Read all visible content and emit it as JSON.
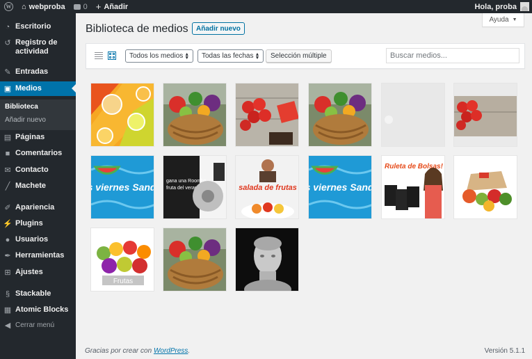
{
  "adminbar": {
    "site_name": "webproba",
    "comments_count": "0",
    "new_label": "Añadir",
    "greeting": "Hola, proba"
  },
  "sidebar": {
    "items": [
      {
        "label": "Escritorio",
        "icon": "dashboard-icon"
      },
      {
        "label": "Registro de actividad",
        "icon": "activity-log-icon"
      },
      {
        "label": "Entradas",
        "icon": "pin-icon"
      },
      {
        "label": "Medios",
        "icon": "media-icon"
      },
      {
        "label": "Páginas",
        "icon": "pages-icon"
      },
      {
        "label": "Comentarios",
        "icon": "comments-icon"
      },
      {
        "label": "Contacto",
        "icon": "mail-icon"
      },
      {
        "label": "Machete",
        "icon": "machete-icon"
      },
      {
        "label": "Apariencia",
        "icon": "brush-icon"
      },
      {
        "label": "Plugins",
        "icon": "plugin-icon"
      },
      {
        "label": "Usuarios",
        "icon": "users-icon"
      },
      {
        "label": "Herramientas",
        "icon": "wrench-icon"
      },
      {
        "label": "Ajustes",
        "icon": "settings-icon"
      },
      {
        "label": "Stackable",
        "icon": "stackable-icon"
      },
      {
        "label": "Atomic Blocks",
        "icon": "atomic-blocks-icon"
      }
    ],
    "submenu": [
      {
        "label": "Biblioteca"
      },
      {
        "label": "Añadir nuevo"
      }
    ],
    "collapse_label": "Cerrar menú"
  },
  "help_tab": {
    "label": "Ayuda"
  },
  "page": {
    "title": "Biblioteca de medios",
    "add_new_label": "Añadir nuevo"
  },
  "toolbar": {
    "type_filter": "Todos los medios",
    "date_filter": "Todas las fechas",
    "bulk_select_label": "Selección múltiple",
    "search_placeholder": "Buscar medios..."
  },
  "media": [
    {
      "kind": "oranges",
      "caption": ""
    },
    {
      "kind": "vegetable-basket",
      "caption": ""
    },
    {
      "kind": "tomatoes-wood",
      "caption": ""
    },
    {
      "kind": "vegetable-basket",
      "caption": ""
    },
    {
      "kind": "placeholder",
      "caption": ""
    },
    {
      "kind": "tomatoes-wood-plain",
      "caption": ""
    },
    {
      "kind": "watermelon-pool",
      "caption": "Los viernes Sandía!!"
    },
    {
      "kind": "roomba-promo",
      "caption": ""
    },
    {
      "kind": "salad-promo",
      "caption": "salada de frutas"
    },
    {
      "kind": "watermelon-pool",
      "caption": "Los viernes Sandía!!"
    },
    {
      "kind": "bags-promo",
      "caption": "Ruleta de Bolsas!"
    },
    {
      "kind": "veg-box",
      "caption": ""
    },
    {
      "kind": "fruit-pile",
      "caption": "Frutas"
    },
    {
      "kind": "vegetable-basket",
      "caption": ""
    },
    {
      "kind": "bust",
      "caption": ""
    }
  ],
  "footer": {
    "thanks_prefix": "Gracias por crear con ",
    "thanks_link": "WordPress",
    "thanks_suffix": ".",
    "version": "Versión 5.1.1"
  },
  "colors": {
    "adminbar_bg": "#23282d",
    "menu_current": "#0073aa",
    "link": "#0073aa"
  }
}
